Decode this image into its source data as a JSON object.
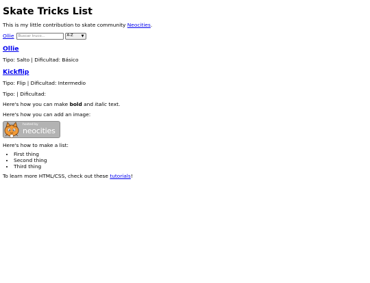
{
  "page": {
    "title": "Skate Tricks List",
    "intro_text": "This is my little contribution to skate community ",
    "intro_link": "Neocities",
    "intro_end": "."
  },
  "controls": {
    "trick_link": "Ollie",
    "search_placeholder": "Buscar truco...",
    "sort_value": "A-Z"
  },
  "tricks": [
    {
      "name": "Ollie",
      "details": "Tipo: Salto | Dificultad: Básico"
    },
    {
      "name": "Kickflip",
      "details": "Tipo: Flip | Dificultad: Intermedio"
    }
  ],
  "empty_trick": {
    "details": "Tipo: | Dificultad:"
  },
  "formatting": {
    "before": "Here's how you can make ",
    "bold": "bold",
    "middle": " and ",
    "italic": "italic",
    "after": " text."
  },
  "image_line": "Here's how you can add an image:",
  "badge": {
    "small_text": "hosted by",
    "big_text": "neocities",
    "icon": "neocities-cat-icon"
  },
  "list_intro": "Here's how to make a list:",
  "list_items": [
    "First thing",
    "Second thing",
    "Third thing"
  ],
  "footer": {
    "text": "To learn more HTML/CSS, check out these ",
    "link": "tutorials",
    "end": "!"
  },
  "colors": {
    "link": "#0000ee",
    "badge_bg": "#b3b3b3",
    "cat_orange": "#f29a36"
  }
}
